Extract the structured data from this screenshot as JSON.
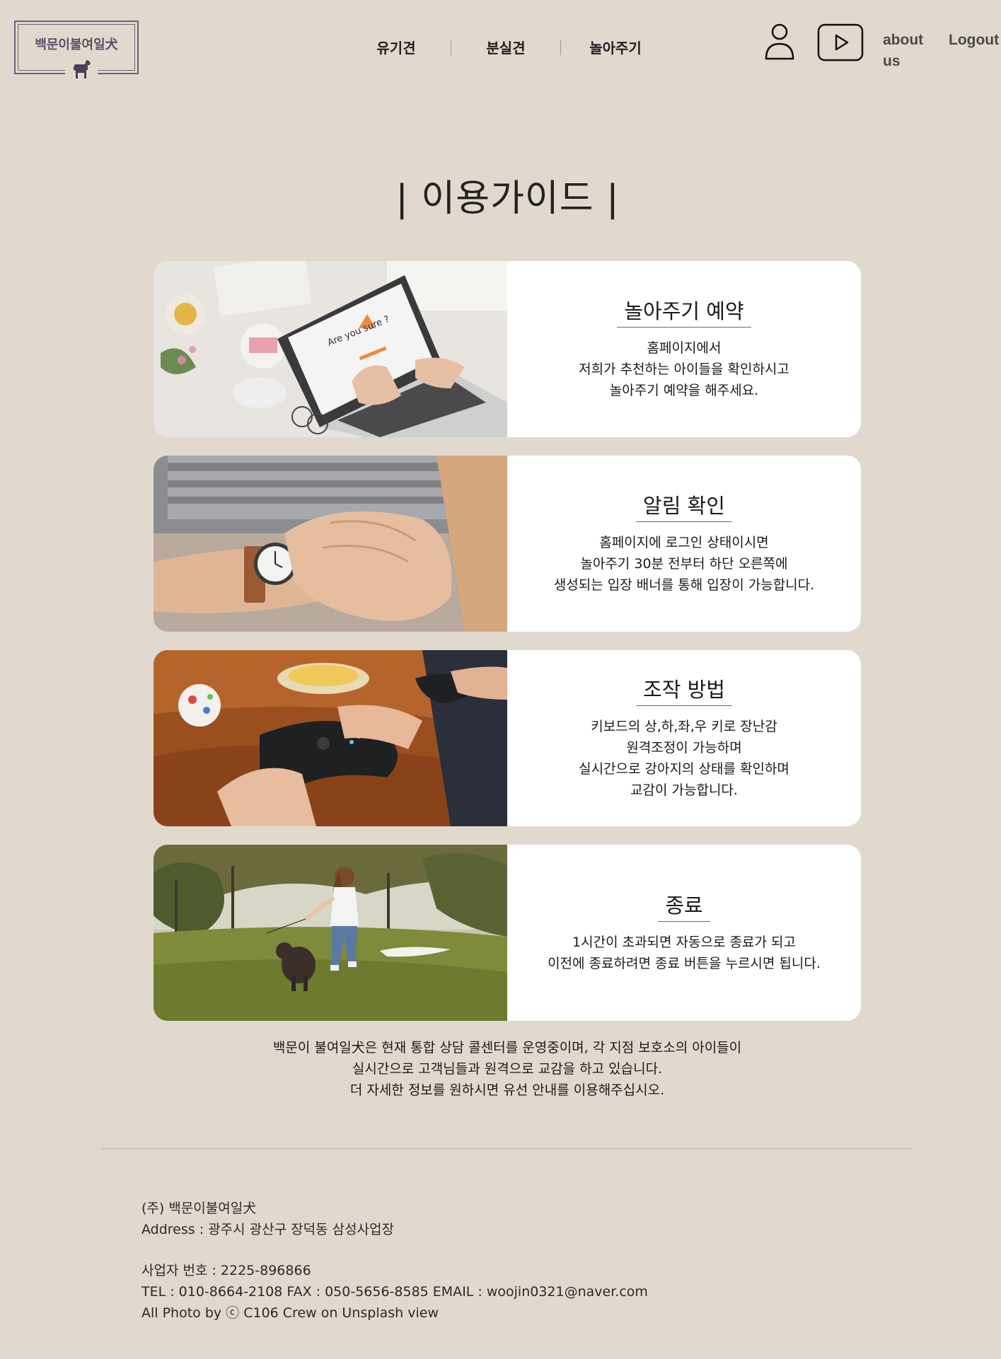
{
  "header": {
    "logo_text": "백문이불여일犬",
    "nav": [
      "유기견",
      "분실견",
      "놀아주기"
    ],
    "about_label": "about us",
    "logout_label": "Logout"
  },
  "page_title": "| 이용가이드 |",
  "cards": [
    {
      "title": "놀아주기 예약",
      "lines": [
        "홈페이지에서",
        "저희가 추천하는 아이들을 확인하시고",
        "놀아주기 예약을 해주세요."
      ],
      "image_text": "Are you sure ?"
    },
    {
      "title": "알림 확인",
      "lines": [
        "홈페이지에 로그인 상태이시면",
        "놀아주기 30분 전부터 하단 오른쪽에",
        "생성되는 입장 배너를 통해 입장이 가능합니다."
      ]
    },
    {
      "title": "조작 방법",
      "lines": [
        "키보드의 상,하,좌,우 키로 장난감",
        "원격조정이 가능하며",
        "실시간으로 강아지의 상태를 확인하며",
        "교감이 가능합니다."
      ]
    },
    {
      "title": "종료",
      "lines": [
        "1시간이 초과되면 자동으로 종료가 되고",
        "이전에 종료하려면 종료 버튼을 누르시면 됩니다."
      ]
    }
  ],
  "info_lines": [
    "백문이 불여일犬은 현재 통합 상담 콜센터를 운영중이며, 각 지점 보호소의 아이들이",
    "실시간으로 고객님들과 원격으로 교감을 하고 있습니다.",
    "더 자세한 정보를 원하시면 유선 안내를 이용해주십시오."
  ],
  "footer": {
    "company": "(주) 백문이불여일犬",
    "address": "Address : 광주시 광산구 장덕동 삼성사업장",
    "business_no": "사업자 번호 : 2225-896866",
    "contact": "TEL : 010-8664-2108 FAX : 050-5656-8585 EMAIL : woojin0321@naver.com",
    "credit": "All Photo by ⓒ C106 Crew on Unsplash view"
  },
  "icons": [
    "user-icon",
    "youtube-play-icon",
    "dog-icon"
  ],
  "colors": {
    "background": "#e2d9ce",
    "card": "#ffffff",
    "logo_accent": "#5c5068"
  }
}
